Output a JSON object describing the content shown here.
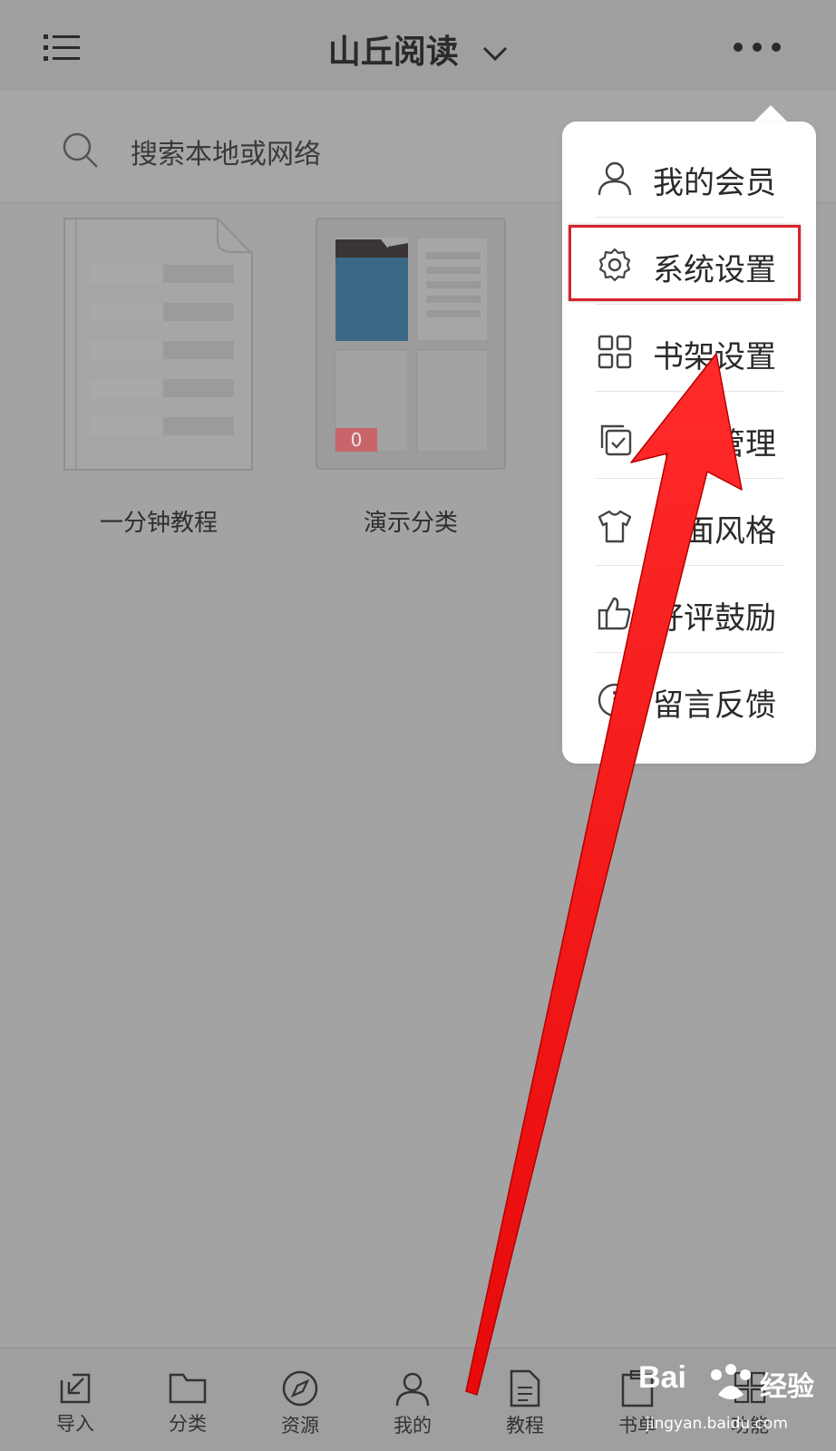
{
  "header": {
    "title": "山丘阅读"
  },
  "search": {
    "placeholder": "搜索本地或网络"
  },
  "shelf": {
    "books": [
      {
        "label": "一分钟教程"
      },
      {
        "label": "演示分类",
        "badge": "0"
      }
    ]
  },
  "menu": {
    "items": [
      {
        "label": "我的会员",
        "icon": "user-icon"
      },
      {
        "label": "系统设置",
        "icon": "gear-icon"
      },
      {
        "label": "书架设置",
        "icon": "grid-icon"
      },
      {
        "label": "书籍管理",
        "icon": "check-copy-icon"
      },
      {
        "label": "界面风格",
        "icon": "shirt-icon"
      },
      {
        "label": "好评鼓励",
        "icon": "thumbs-up-icon"
      },
      {
        "label": "留言反馈",
        "icon": "info-icon"
      }
    ]
  },
  "tabs": [
    {
      "label": "导入",
      "icon": "import-icon"
    },
    {
      "label": "分类",
      "icon": "folder-icon"
    },
    {
      "label": "资源",
      "icon": "compass-icon"
    },
    {
      "label": "我的",
      "icon": "user-icon"
    },
    {
      "label": "教程",
      "icon": "document-icon"
    },
    {
      "label": "书单",
      "icon": "clipboard-icon"
    },
    {
      "label": "功能",
      "icon": "function-icon"
    }
  ],
  "watermark": {
    "brand": "经验",
    "url": "jingyan.baidu.com"
  },
  "colors": {
    "overlay": "#a3a3a3",
    "highlight": "#d8232a",
    "arrow": "#ee0f0f",
    "folder": "#3b6886",
    "badge": "#c9656a"
  }
}
